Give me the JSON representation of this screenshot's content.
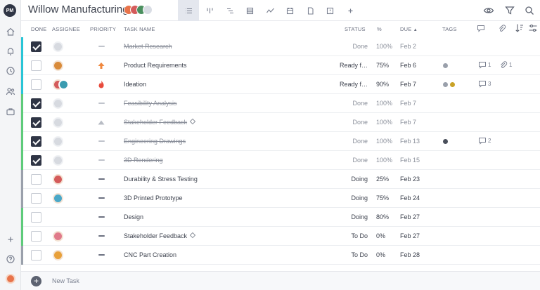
{
  "app": {
    "logo_text": "PM",
    "project_title": "Willow Manufacturing"
  },
  "header": {
    "views": [
      "list-view-icon",
      "board-view-icon",
      "gantt-view-icon",
      "sheet-view-icon",
      "dashboard-view-icon",
      "calendar-view-icon",
      "files-view-icon",
      "overview-icon",
      "add-view-icon"
    ],
    "active_view": "list-view-icon",
    "tools": [
      "eye-icon",
      "filter-icon",
      "search-icon"
    ]
  },
  "sidebar": {
    "icons": [
      "home-icon",
      "notifications-icon",
      "timesheet-icon",
      "team-icon",
      "portfolio-icon",
      "add-icon",
      "help-icon",
      "user-avatar"
    ]
  },
  "columns": {
    "done": "DONE",
    "assignee": "ASSIGNEE",
    "priority": "PRIORITY",
    "task_name": "TASK NAME",
    "status": "STATUS",
    "pct": "%",
    "due": "DUE",
    "due_sort": "▲",
    "tags": "TAGS"
  },
  "colors": {
    "accent_teal": "#29c5d6",
    "accent_green": "#5ecb7a",
    "accent_gray": "#9aa0ab",
    "priority_high": "#f0883e",
    "priority_critical": "#e84b3c"
  },
  "rows": [
    {
      "name": "Market Research",
      "done": true,
      "priority": "low",
      "status": "Done",
      "pct": "100%",
      "due": "Feb 2",
      "stripe": "#29c5d6",
      "assignee": [
        "placeholder"
      ],
      "tags": [],
      "comments": "",
      "attachments": ""
    },
    {
      "name": "Product Requirements",
      "done": false,
      "priority": "high",
      "status": "Ready f…",
      "pct": "75%",
      "due": "Feb 6",
      "stripe": "#29c5d6",
      "assignee": [
        "person-a"
      ],
      "tags": [
        "#9aa0ab"
      ],
      "comments": "1",
      "attachments": "1"
    },
    {
      "name": "Ideation",
      "done": false,
      "priority": "critical",
      "status": "Ready f…",
      "pct": "90%",
      "due": "Feb 7",
      "stripe": "#29c5d6",
      "assignee": [
        "person-b",
        "person-c"
      ],
      "tags": [
        "#9aa0ab",
        "#c9a227"
      ],
      "comments": "3",
      "attachments": ""
    },
    {
      "name": "Feasibility Analysis",
      "done": true,
      "priority": "low",
      "status": "Done",
      "pct": "100%",
      "due": "Feb 7",
      "stripe": "#5ecb7a",
      "assignee": [
        "placeholder"
      ],
      "tags": [],
      "comments": "",
      "attachments": ""
    },
    {
      "name": "Stakeholder Feedback",
      "milestone": true,
      "done": true,
      "priority": "up",
      "status": "Done",
      "pct": "100%",
      "due": "Feb 7",
      "stripe": "#5ecb7a",
      "assignee": [
        "placeholder"
      ],
      "tags": [],
      "comments": "",
      "attachments": ""
    },
    {
      "name": "Engineering Drawings",
      "done": true,
      "priority": "low",
      "status": "Done",
      "pct": "100%",
      "due": "Feb 13",
      "stripe": "#5ecb7a",
      "assignee": [
        "placeholder"
      ],
      "tags": [
        "#4a4f5b"
      ],
      "comments": "2",
      "attachments": ""
    },
    {
      "name": "3D Rendering",
      "done": true,
      "priority": "low",
      "status": "Done",
      "pct": "100%",
      "due": "Feb 15",
      "stripe": "#5ecb7a",
      "assignee": [
        "placeholder"
      ],
      "tags": [],
      "comments": "",
      "attachments": ""
    },
    {
      "name": "Durability & Stress Testing",
      "done": false,
      "priority": "medium",
      "status": "Doing",
      "pct": "25%",
      "due": "Feb 23",
      "stripe": "#9aa0ab",
      "assignee": [
        "person-b"
      ],
      "tags": [],
      "comments": "",
      "attachments": ""
    },
    {
      "name": "3D Printed Prototype",
      "done": false,
      "priority": "medium",
      "status": "Doing",
      "pct": "75%",
      "due": "Feb 24",
      "stripe": "#9aa0ab",
      "assignee": [
        "person-d"
      ],
      "tags": [],
      "comments": "",
      "attachments": ""
    },
    {
      "name": "Design",
      "done": false,
      "priority": "medium",
      "status": "Doing",
      "pct": "80%",
      "due": "Feb 27",
      "stripe": "#5ecb7a",
      "assignee": [],
      "tags": [],
      "comments": "",
      "attachments": ""
    },
    {
      "name": "Stakeholder Feedback",
      "milestone": true,
      "done": false,
      "priority": "medium",
      "status": "To Do",
      "pct": "0%",
      "due": "Feb 27",
      "stripe": "#5ecb7a",
      "assignee": [
        "person-e"
      ],
      "tags": [],
      "comments": "",
      "attachments": ""
    },
    {
      "name": "CNC Part Creation",
      "done": false,
      "priority": "medium",
      "status": "To Do",
      "pct": "0%",
      "due": "Feb 28",
      "stripe": "#9aa0ab",
      "assignee": [
        "person-f"
      ],
      "tags": [],
      "comments": "",
      "attachments": ""
    }
  ],
  "new_task": {
    "label": "New Task"
  }
}
